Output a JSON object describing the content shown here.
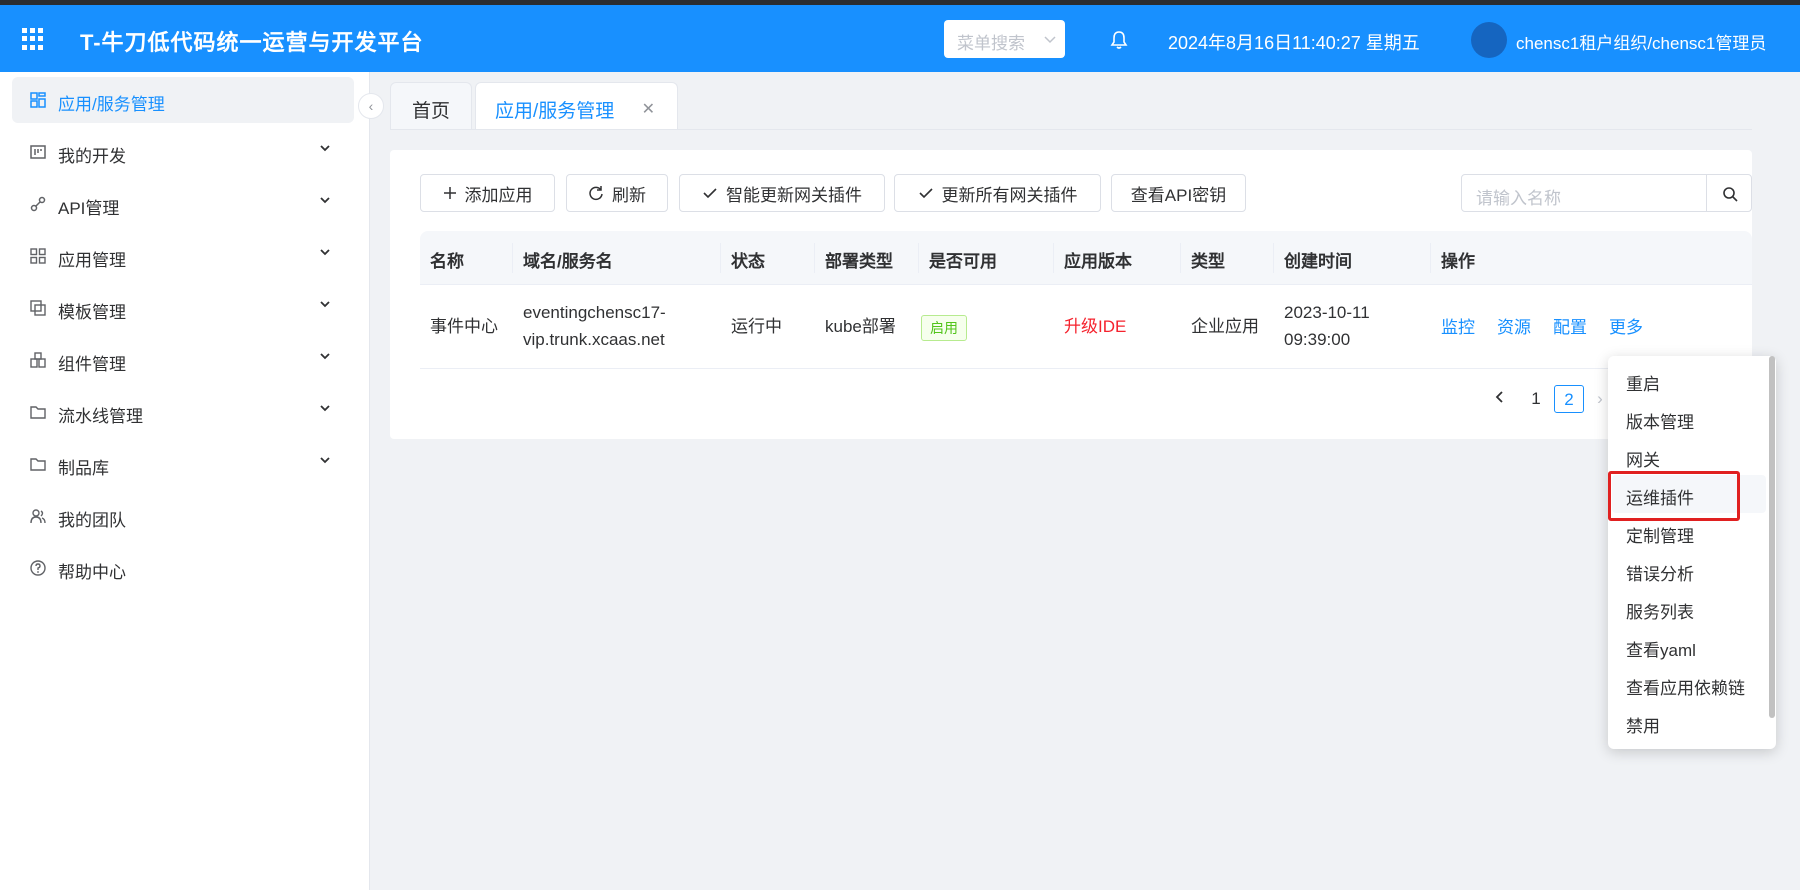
{
  "header": {
    "title": "T-牛刀低代码统一运营与开发平台",
    "menu_search_placeholder": "菜单搜索",
    "datetime": "2024年8月16日11:40:27 星期五",
    "user": "chensc1租户组织/chensc1管理员"
  },
  "sidebar": {
    "items": [
      {
        "label": "应用/服务管理",
        "icon": "app-grid-icon",
        "active": true
      },
      {
        "label": "我的开发",
        "icon": "board-icon"
      },
      {
        "label": "API管理",
        "icon": "link-icon"
      },
      {
        "label": "应用管理",
        "icon": "grid-icon"
      },
      {
        "label": "模板管理",
        "icon": "template-icon"
      },
      {
        "label": "组件管理",
        "icon": "component-icon"
      },
      {
        "label": "流水线管理",
        "icon": "folder-icon"
      },
      {
        "label": "制品库",
        "icon": "folder-icon"
      },
      {
        "label": "我的团队",
        "icon": "team-icon"
      },
      {
        "label": "帮助中心",
        "icon": "help-icon"
      }
    ]
  },
  "tabs": {
    "home": "首页",
    "current": "应用/服务管理"
  },
  "toolbar": {
    "add": "添加应用",
    "refresh": "刷新",
    "smart_update": "智能更新网关插件",
    "update_all": "更新所有网关插件",
    "view_api_key": "查看API密钥",
    "search_placeholder": "请输入名称"
  },
  "table": {
    "columns": [
      "名称",
      "域名/服务名",
      "状态",
      "部署类型",
      "是否可用",
      "应用版本",
      "类型",
      "创建时间",
      "操作"
    ],
    "rows": [
      {
        "name": "事件中心",
        "domain_line1": "eventingchensc17-",
        "domain_line2": "vip.trunk.xcaas.net",
        "status": "运行中",
        "deploy": "kube部署",
        "available": "启用",
        "version": "升级IDE",
        "type": "企业应用",
        "created_date": "2023-10-11",
        "created_time": "09:39:00",
        "ops": [
          "监控",
          "资源",
          "配置",
          "更多"
        ]
      }
    ]
  },
  "pagination": {
    "pages": [
      "1",
      "2"
    ],
    "current": "2"
  },
  "more_menu": {
    "items": [
      "重启",
      "版本管理",
      "网关",
      "运维插件",
      "定制管理",
      "错误分析",
      "服务列表",
      "查看yaml",
      "查看应用依赖链",
      "禁用"
    ],
    "highlighted": "运维插件"
  },
  "colors": {
    "primary": "#1890ff",
    "danger": "#f5222d",
    "success": "#52c41a",
    "highlight_box": "#e02020"
  }
}
